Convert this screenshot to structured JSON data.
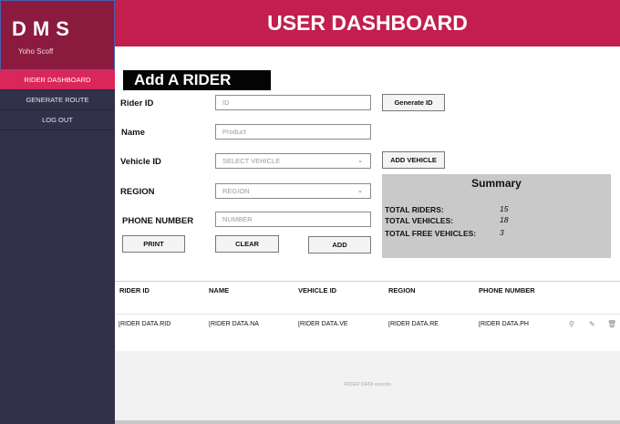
{
  "brand": {
    "name": "DMS",
    "user": "Yoho Scoff"
  },
  "sidebar": {
    "items": [
      {
        "label": "RIDER DASHBOARD"
      },
      {
        "label": "GENERATE ROUTE"
      },
      {
        "label": "LOG OUT"
      }
    ]
  },
  "header": {
    "title": "USER DASHBOARD"
  },
  "form": {
    "title": "Add A RIDER",
    "rider_id_label": "Rider ID",
    "rider_id_placeholder": "ID",
    "generate_id_button": "Generate ID",
    "name_label": "Name",
    "name_placeholder": "Product",
    "vehicle_label": "Vehicle ID",
    "vehicle_selected": "SELECT VEHICLE",
    "add_vehicle_button": "ADD VEHICLE",
    "region_label": "REGION",
    "region_selected": "REGION",
    "phone_label": "PHONE NUMBER",
    "phone_placeholder": "NUMBER",
    "print_button": "PRINT",
    "clear_button": "CLEAR",
    "add_button": "ADD"
  },
  "summary": {
    "title": "Summary",
    "riders_label": "TOTAL RIDERS:",
    "riders_value": "15",
    "vehicles_label": "TOTAL VEHICLES:",
    "vehicles_value": "18",
    "free_label": "TOTAL FREE VEHICLES:",
    "free_value": "3"
  },
  "table": {
    "headers": [
      "RIDER ID",
      "NAME",
      "VEHICLE ID",
      "REGION",
      "PHONE NUMBER"
    ],
    "row": [
      "[RIDER DATA.RID",
      "[RIDER DATA.NA",
      "[RIDER DATA.VE",
      "[RIDER DATA.RE",
      "[RIDER DATA.PH"
    ],
    "footer": "RIDER DATA records"
  },
  "icons": {
    "search": "search-icon",
    "edit": "pencil-icon",
    "delete": "trash-icon"
  }
}
